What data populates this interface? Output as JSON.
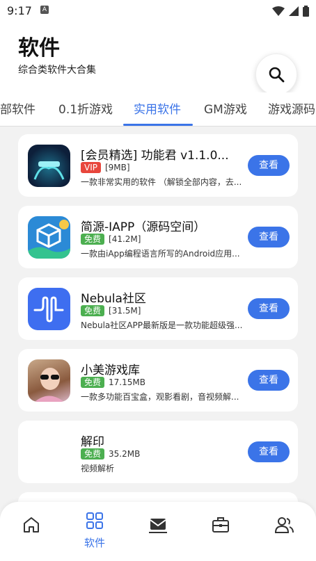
{
  "status_bar": {
    "time": "9:17",
    "badge": "A"
  },
  "header": {
    "title": "软件",
    "subtitle": "综合类软件大合集"
  },
  "tabs": [
    {
      "label": "部软件"
    },
    {
      "label": "0.1折游戏"
    },
    {
      "label": "实用软件"
    },
    {
      "label": "GM游戏"
    },
    {
      "label": "游戏源码"
    }
  ],
  "apps": [
    {
      "name": "[会员精选] 功能君 v1.1.0...",
      "badge": "VIP",
      "size": "[9MB]",
      "desc": "一款非常实用的软件 （解锁全部内容，去...",
      "button": "查看"
    },
    {
      "name": "简源-IAPP（源码空间）",
      "badge": "免费",
      "size": "[41.2M]",
      "desc": "一款由iApp编程语言所写的Android应用...",
      "button": "查看"
    },
    {
      "name": "Nebula社区",
      "badge": "免费",
      "size": "[31.5M]",
      "desc": "Nebula社区APP最新版是一款功能超级强...",
      "button": "查看"
    },
    {
      "name": "小美游戏库",
      "badge": "免费",
      "size": "17.15MB",
      "desc": "一款多功能百宝盒，观影看剧，音视频解...",
      "button": "查看"
    },
    {
      "name": "解印",
      "badge": "免费",
      "size": "35.2MB",
      "desc": "视频解析",
      "button": "查看"
    }
  ],
  "bottom_nav": {
    "active_label": "软件"
  },
  "colors": {
    "accent": "#3b74e8",
    "vip": "#e8463c",
    "free": "#4caf50"
  }
}
